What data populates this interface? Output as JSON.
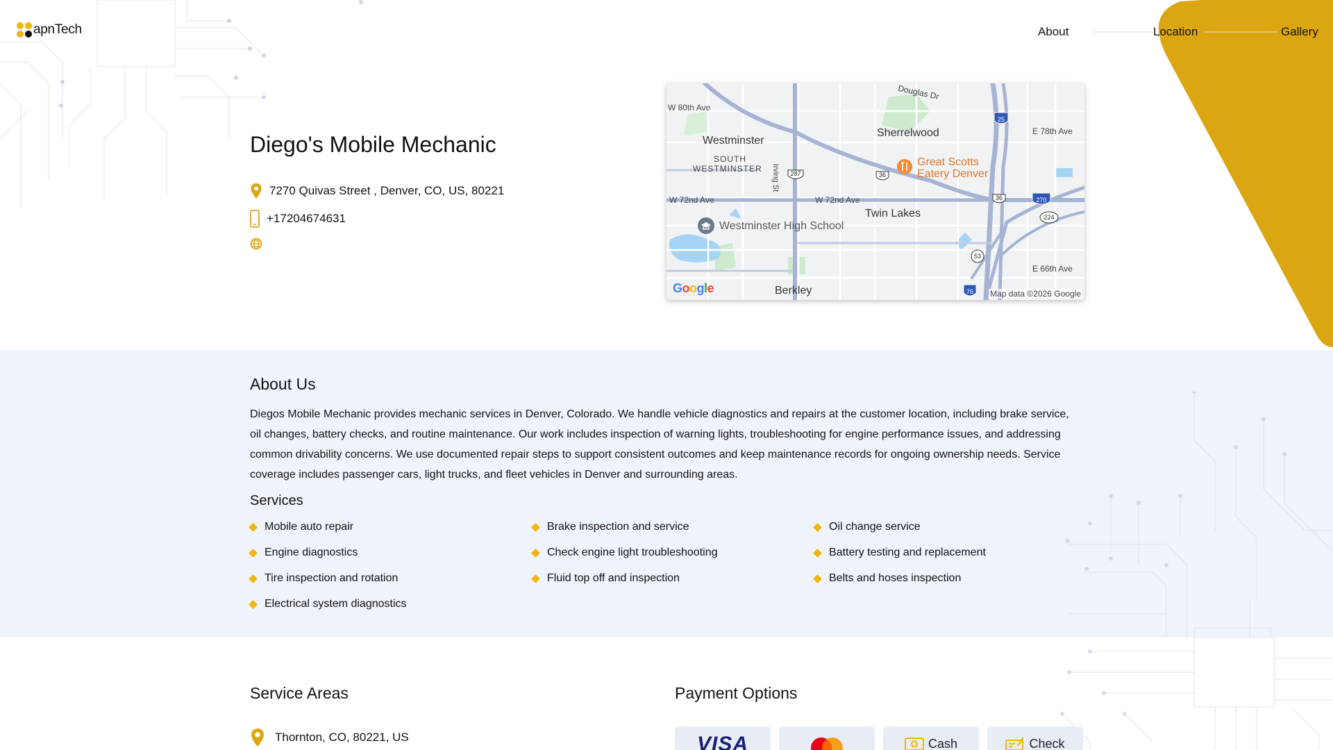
{
  "header": {
    "logo_text": "apnTech",
    "nav": [
      "About",
      "Location",
      "Gallery"
    ]
  },
  "business": {
    "name": "Diego's Mobile Mechanic",
    "address": "7270 Quivas Street , Denver, CO, US, 80221",
    "phone": "+17204674631"
  },
  "map": {
    "labels": {
      "w80": "W 80th Ave",
      "douglas": "Douglas Dr",
      "westminster": "Westminster",
      "south_westminster_1": "SOUTH",
      "south_westminster_2": "WESTMINSTER",
      "irving": "Irving St",
      "sherrelwood": "Sherrelwood",
      "e78": "E 78th Ave",
      "great_scotts_1": "Great Scotts",
      "great_scotts_2": "Eatery Denver",
      "w72a": "W 72nd Ave",
      "w72b": "W 72nd Ave",
      "twin_lakes": "Twin Lakes",
      "westminster_hs": "Westminster High School",
      "e66": "E 66th Ave",
      "berkley": "Berkley",
      "shield_287": "287",
      "shield_36a": "36",
      "shield_36b": "36",
      "shield_25": "25",
      "shield_270": "270",
      "shield_224": "224",
      "shield_53": "53",
      "shield_76": "76"
    },
    "google_logo": "Google",
    "attribution": "Map data ©2026 Google"
  },
  "about": {
    "title": "About Us",
    "text": "Diegos Mobile Mechanic provides mechanic services in Denver, Colorado. We handle vehicle diagnostics and repairs at the customer location, including brake service, oil changes, battery checks, and routine maintenance. Our work includes inspection of warning lights, troubleshooting for engine performance issues, and addressing common drivability concerns. We use documented repair steps to support consistent outcomes and keep maintenance records for ongoing ownership needs. Service coverage includes passenger cars, light trucks, and fleet vehicles in Denver and surrounding areas."
  },
  "services": {
    "title": "Services",
    "items": [
      "Mobile auto repair",
      "Brake inspection and service",
      "Oil change service",
      "Engine diagnostics",
      "Check engine light troubleshooting",
      "Battery testing and replacement",
      "Tire inspection and rotation",
      "Fluid top off and inspection",
      "Belts and hoses inspection",
      "Electrical system diagnostics"
    ]
  },
  "service_areas": {
    "title": "Service Areas",
    "items": [
      "Thornton, CO, 80221, US"
    ]
  },
  "payment": {
    "title": "Payment Options",
    "options": [
      "VISA",
      "Mastercard",
      "Cash",
      "Check"
    ]
  },
  "colors": {
    "accent": "#f2b50b",
    "section_bg": "#eff3fa",
    "card_bg": "#e7ecf5",
    "visa_blue": "#1a1f71",
    "mc_red": "#eb001b",
    "mc_orange": "#f79e1b"
  }
}
